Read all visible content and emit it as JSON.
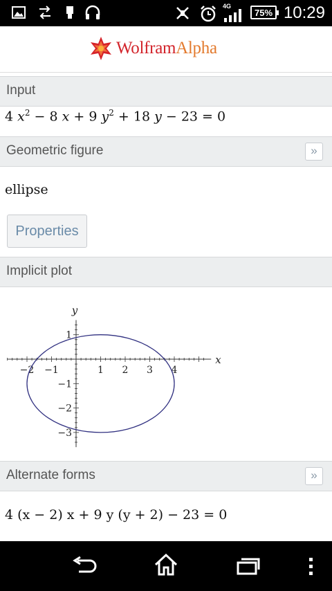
{
  "status_bar": {
    "time": "10:29",
    "battery": "75%",
    "network": "4G",
    "icons": [
      "image-icon",
      "sync-icon",
      "usb-icon",
      "headphones-icon",
      "mute-icon",
      "alarm-icon",
      "signal-icon"
    ]
  },
  "header": {
    "brand_main": "Wolfram",
    "brand_alpha": "Alpha"
  },
  "pods": {
    "input": {
      "title": "Input",
      "expr_parts": [
        "4",
        "x",
        "2",
        " − 8 ",
        "x",
        " + 9 ",
        "y",
        "2",
        " + 18 ",
        "y",
        " − 23 = 0"
      ]
    },
    "geometric_figure": {
      "title": "Geometric figure",
      "value": "ellipse",
      "button": "Properties",
      "more": "»"
    },
    "implicit_plot": {
      "title": "Implicit plot"
    },
    "alternate_forms": {
      "title": "Alternate forms",
      "more": "»",
      "expr": "4 (x − 2) x + 9 y (y + 2) − 23 = 0"
    }
  },
  "chart_data": {
    "type": "line",
    "title": "",
    "xlabel": "x",
    "ylabel": "y",
    "xlim": [
      -2.8,
      5.5
    ],
    "ylim": [
      -3.6,
      1.6
    ],
    "x_ticks": [
      -2,
      -1,
      1,
      2,
      3,
      4
    ],
    "y_ticks": [
      1,
      -1,
      -2,
      -3
    ],
    "x_tick_labels": [
      "−2",
      "−1",
      "1",
      "2",
      "3",
      "4"
    ],
    "y_tick_labels": [
      "1",
      "−1",
      "−2",
      "−3"
    ],
    "curve": {
      "shape": "ellipse",
      "center": [
        1,
        -1
      ],
      "semi_axis_x": 3,
      "semi_axis_y": 2,
      "color": "#303080"
    },
    "grid": false
  },
  "nav_bar": {
    "icons": [
      "back-icon",
      "home-icon",
      "recents-icon",
      "menu-icon"
    ]
  }
}
